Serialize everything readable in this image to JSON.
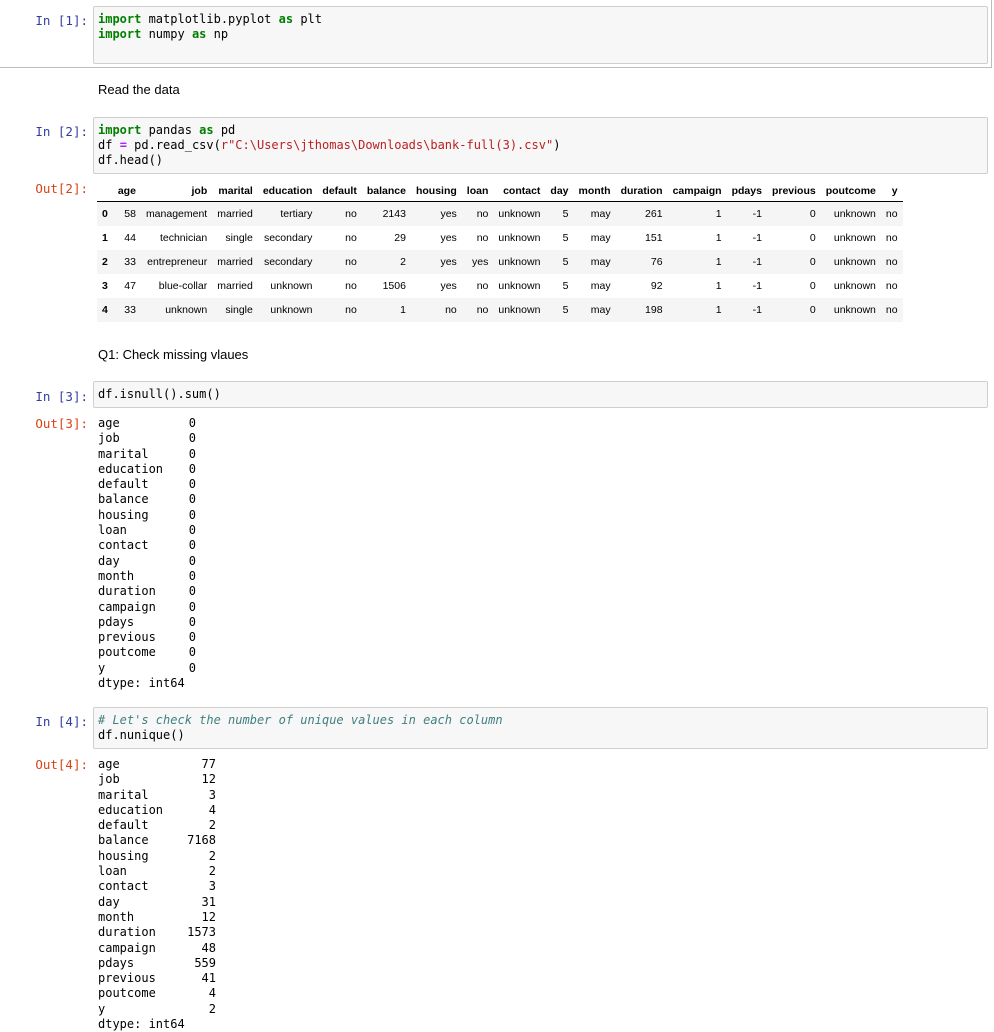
{
  "cells": {
    "c1": {
      "prompt": "In [1]:",
      "line1": {
        "kw1": "import",
        "t1": " matplotlib.pyplot ",
        "kw2": "as",
        "t2": " plt"
      },
      "line2": {
        "kw1": "import",
        "t1": " numpy ",
        "kw2": "as",
        "t2": " np"
      }
    },
    "md1": "Read the data",
    "c2": {
      "prompt": "In [2]:",
      "line1": {
        "kw1": "import",
        "t1": " pandas ",
        "kw2": "as",
        "t2": " pd"
      },
      "line2": {
        "t1": "df ",
        "op": "=",
        "t2": " pd.read_csv(",
        "str": "r\"C:\\Users\\jthomas\\Downloads\\bank-full(3).csv\"",
        "t3": ")"
      },
      "line3": "df.head()",
      "out_prompt": "Out[2]:"
    },
    "md2": "Q1: Check missing vlaues",
    "c3": {
      "prompt": "In [3]:",
      "code": "df.isnull().sum()",
      "out_prompt": "Out[3]:",
      "dtype": "dtype: int64"
    },
    "c4": {
      "prompt": "In [4]:",
      "comment": "# Let's check the number of unique values in each column",
      "code": "df.nunique()",
      "out_prompt": "Out[4]:",
      "dtype": "dtype: int64"
    }
  },
  "head_table": {
    "columns": [
      "",
      "age",
      "job",
      "marital",
      "education",
      "default",
      "balance",
      "housing",
      "loan",
      "contact",
      "day",
      "month",
      "duration",
      "campaign",
      "pdays",
      "previous",
      "poutcome",
      "y"
    ],
    "rows": [
      [
        "0",
        "58",
        "management",
        "married",
        "tertiary",
        "no",
        "2143",
        "yes",
        "no",
        "unknown",
        "5",
        "may",
        "261",
        "1",
        "-1",
        "0",
        "unknown",
        "no"
      ],
      [
        "1",
        "44",
        "technician",
        "single",
        "secondary",
        "no",
        "29",
        "yes",
        "no",
        "unknown",
        "5",
        "may",
        "151",
        "1",
        "-1",
        "0",
        "unknown",
        "no"
      ],
      [
        "2",
        "33",
        "entrepreneur",
        "married",
        "secondary",
        "no",
        "2",
        "yes",
        "yes",
        "unknown",
        "5",
        "may",
        "76",
        "1",
        "-1",
        "0",
        "unknown",
        "no"
      ],
      [
        "3",
        "47",
        "blue-collar",
        "married",
        "unknown",
        "no",
        "1506",
        "yes",
        "no",
        "unknown",
        "5",
        "may",
        "92",
        "1",
        "-1",
        "0",
        "unknown",
        "no"
      ],
      [
        "4",
        "33",
        "unknown",
        "single",
        "unknown",
        "no",
        "1",
        "no",
        "no",
        "unknown",
        "5",
        "may",
        "198",
        "1",
        "-1",
        "0",
        "unknown",
        "no"
      ]
    ]
  },
  "isnull_series": [
    [
      "age",
      "0"
    ],
    [
      "job",
      "0"
    ],
    [
      "marital",
      "0"
    ],
    [
      "education",
      "0"
    ],
    [
      "default",
      "0"
    ],
    [
      "balance",
      "0"
    ],
    [
      "housing",
      "0"
    ],
    [
      "loan",
      "0"
    ],
    [
      "contact",
      "0"
    ],
    [
      "day",
      "0"
    ],
    [
      "month",
      "0"
    ],
    [
      "duration",
      "0"
    ],
    [
      "campaign",
      "0"
    ],
    [
      "pdays",
      "0"
    ],
    [
      "previous",
      "0"
    ],
    [
      "poutcome",
      "0"
    ],
    [
      "y",
      "0"
    ]
  ],
  "nunique_series": [
    [
      "age",
      "77"
    ],
    [
      "job",
      "12"
    ],
    [
      "marital",
      "3"
    ],
    [
      "education",
      "4"
    ],
    [
      "default",
      "2"
    ],
    [
      "balance",
      "7168"
    ],
    [
      "housing",
      "2"
    ],
    [
      "loan",
      "2"
    ],
    [
      "contact",
      "3"
    ],
    [
      "day",
      "31"
    ],
    [
      "month",
      "12"
    ],
    [
      "duration",
      "1573"
    ],
    [
      "campaign",
      "48"
    ],
    [
      "pdays",
      "559"
    ],
    [
      "previous",
      "41"
    ],
    [
      "poutcome",
      "4"
    ],
    [
      "y",
      "2"
    ]
  ]
}
